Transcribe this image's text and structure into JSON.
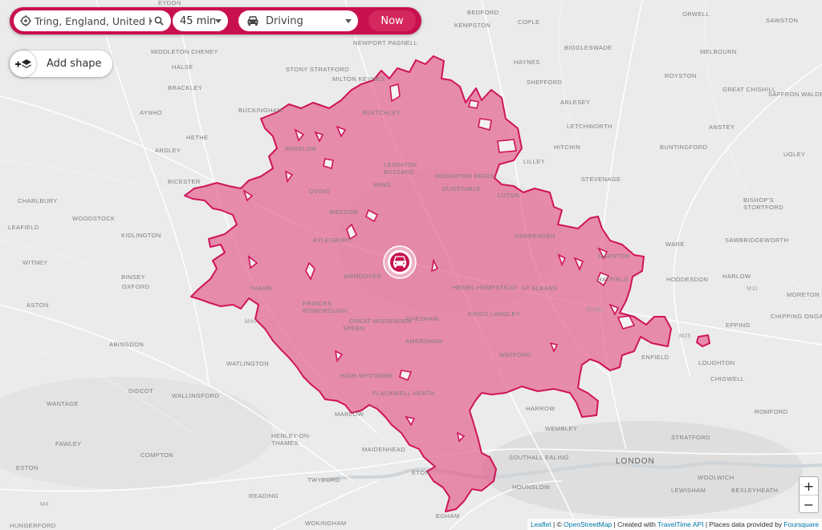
{
  "search": {
    "location": "Tring, England, United Kingdom",
    "duration": "45 min",
    "mode": "Driving",
    "time_button": "Now"
  },
  "add_shape": {
    "label": "Add shape"
  },
  "zoom": {
    "in": "+",
    "out": "−"
  },
  "attribution": {
    "leaflet": "Leaflet",
    "sep1": " | © ",
    "osm": "OpenStreetMap",
    "sep2": " | Created with ",
    "traveltime": "TravelTime API",
    "sep3": " | Places data provided by ",
    "foursquare": "Foursquare"
  },
  "colors": {
    "brand": "#c8104f",
    "isochrone_fill": "#e35d8a",
    "isochrone_stroke": "#d0145a",
    "map_background": "#e9e9e9"
  },
  "places": {
    "bedford": "BEDFORD",
    "kempston": "KEMPSTON",
    "cople": "COPLE",
    "orwell": "ORWELL",
    "sawston": "SAWSTON",
    "eydon": "EYDON",
    "newport_pagnell": "NEWPORT PAGNELL",
    "biggleswade": "BIGGLESWADE",
    "middleton_cheney": "MIDDLETON CHENEY",
    "haynes": "HAYNES",
    "melbourn": "MELBOURN",
    "halse": "HALSE",
    "stony_stratford": "STONY STRATFORD",
    "milton_keynes": "MILTON KEYNES",
    "royston": "ROYSTON",
    "brackley": "BRACKLEY",
    "shefford": "SHEFFORD",
    "great_chishill": "GREAT CHISHILL",
    "saffron_walden": "SAFFRON WALDEN",
    "aynho": "AYNHO",
    "buckingham": "BUCKINGHAM",
    "arlesey": "ARLESEY",
    "bletchley": "BLETCHLEY",
    "letchworth": "LETCHWORTH",
    "anstey": "ANSTEY",
    "hethe": "HETHE",
    "hitchin": "HITCHIN",
    "buntingford": "BUNTINGFORD",
    "ardley": "ARDLEY",
    "winslow": "WINSLOW",
    "lilley": "LILLEY",
    "ugley": "UGLEY",
    "leighton_buzzard": "LEIGHTON\nBUZZARD",
    "bicester": "BICESTER",
    "houghton_regis": "HOUGHTON REGIS",
    "wing": "WING",
    "stevenage": "STEVENAGE",
    "oving": "OVING",
    "dunstable": "DUNSTABLE",
    "luton": "LUTON",
    "bishops_stortford": "BISHOP'S\nSTORTFORD",
    "charlbury": "CHARLBURY",
    "woodstock": "WOODSTOCK",
    "weedon": "WEEDON",
    "leafield": "LEAFIELD",
    "kidlington": "KIDLINGTON",
    "aylesbury": "AYLESBURY",
    "harpenden": "HARPENDEN",
    "ware": "WARE",
    "sawbridgeworth": "SAWBRIDGEWORTH",
    "garston": "GARSTON",
    "witney": "WITNEY",
    "binsey": "BINSEY",
    "oxford": "OXFORD",
    "thame": "THAME",
    "wendover": "WENDOVER",
    "hatfield": "HATFIELD",
    "hoddesdon": "HODDESDON",
    "harlow": "HARLOW",
    "hemel": "HEMEL HEMPSTEAD",
    "st_albans": "ST ALBANS",
    "aston": "ASTON",
    "princes_risborough": "PRINCES\nRISBOROUGH",
    "kings_langley": "KINGS LANGLEY",
    "moreton": "MORETON",
    "great_missenden": "GREAT MISSENDEN",
    "chesham": "CHESHAM",
    "speen": "SPEEN",
    "chipping_ongar": "CHIPPING ONGAR",
    "epping": "EPPING",
    "abingdon": "ABINGDON",
    "amersham": "AMERSHAM",
    "watford": "WATFORD",
    "enfield": "ENFIELD",
    "watlington": "WATLINGTON",
    "loughton": "LOUGHTON",
    "high_wycombe": "HIGH WYCOMBE",
    "chigwell": "CHIGWELL",
    "didcot": "DIDCOT",
    "flackwell_heath": "FLACKWELL HEATH",
    "wallingford": "WALLINGFORD",
    "wantage": "WANTAGE",
    "harrow": "HARROW",
    "romford": "ROMFORD",
    "marlow": "MARLOW",
    "wembley": "WEMBLEY",
    "henley": "HENLEY-ON-\nTHAMES",
    "fawley": "FAWLEY",
    "stratford": "STRATFORD",
    "maidenhead": "MAIDENHEAD",
    "compton": "COMPTON",
    "southall": "SOUTHALL",
    "ealing": "EALING",
    "london": "LONDON",
    "eston": "ESTON",
    "twyford": "TWYFORD",
    "eton": "ETON",
    "hounslow": "HOUNSLOW",
    "woolwich": "WOOLWICH",
    "reading": "READING",
    "lewisham": "LEWISHAM",
    "bexleyheath": "BEXLEYHEATH",
    "egham": "EGHAM",
    "hungerford": "HUNGERFORD",
    "wokingham": "WOKINGHAM",
    "m40": "M40",
    "m4": "M4",
    "m25": "M25",
    "m11": "M11",
    "a1m": "A1(M)"
  }
}
